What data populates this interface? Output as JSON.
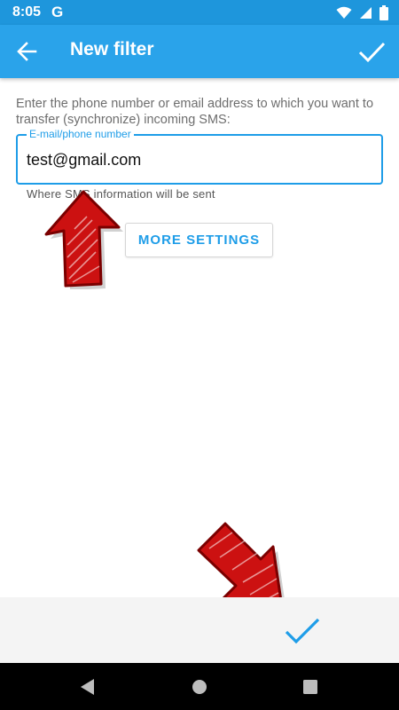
{
  "status_bar": {
    "time": "8:05",
    "google_letter": "G",
    "icons": [
      "wifi-icon",
      "signal-icon",
      "battery-icon"
    ]
  },
  "app_bar": {
    "title": "New filter",
    "back_icon": "arrow-back-icon",
    "confirm_icon": "check-icon"
  },
  "form": {
    "intro": "Enter the phone number or email address to which you want to transfer (synchronize) incoming SMS:",
    "field_label": "E-mail/phone number",
    "field_value": "test@gmail.com",
    "helper": "Where SMS information will be sent",
    "more_settings_label": "MORE SETTINGS"
  },
  "bottom_bar": {
    "confirm_icon": "check-icon"
  },
  "nav_bar": {
    "icons": [
      "nav-back-icon",
      "nav-home-icon",
      "nav-recents-icon"
    ]
  },
  "colors": {
    "status_bar": "#1e96dc",
    "app_bar": "#2aa3ea",
    "accent": "#1e9de8",
    "annotation_arrow": "#cc1111"
  }
}
